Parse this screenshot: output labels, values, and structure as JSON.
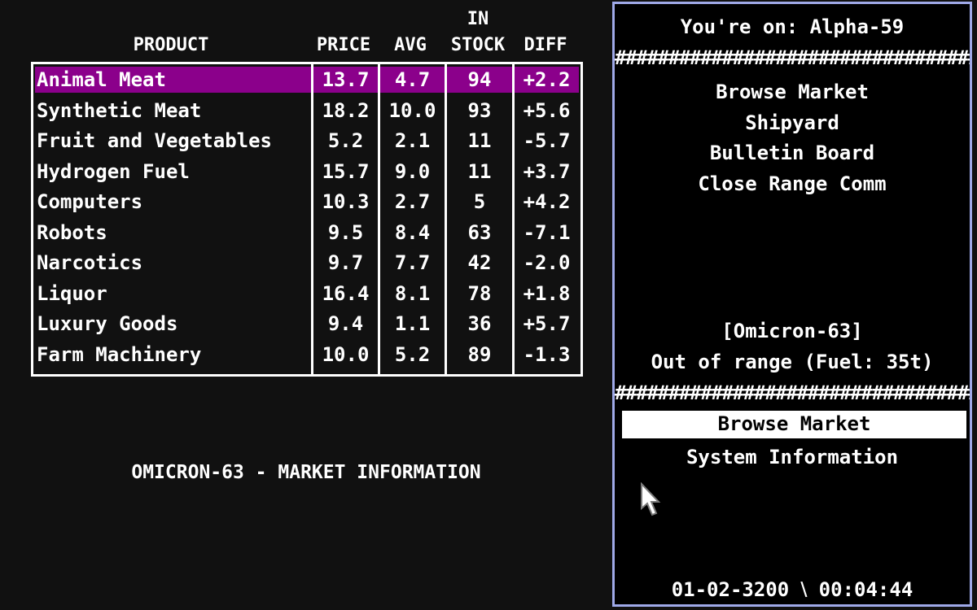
{
  "market": {
    "headers": {
      "product": "PRODUCT",
      "price": "PRICE",
      "avg": "AVG",
      "stock": "IN\nSTOCK",
      "diff": "DIFF"
    },
    "selected_index": 0,
    "rows": [
      {
        "name": "Animal Meat",
        "price": "13.7",
        "avg": "4.7",
        "stock": "94",
        "diff": "+2.2"
      },
      {
        "name": "Synthetic Meat",
        "price": "18.2",
        "avg": "10.0",
        "stock": "93",
        "diff": "+5.6"
      },
      {
        "name": "Fruit and Vegetables",
        "price": "5.2",
        "avg": "2.1",
        "stock": "11",
        "diff": "-5.7"
      },
      {
        "name": "Hydrogen Fuel",
        "price": "15.7",
        "avg": "9.0",
        "stock": "11",
        "diff": "+3.7"
      },
      {
        "name": "Computers",
        "price": "10.3",
        "avg": "2.7",
        "stock": "5",
        "diff": "+4.2"
      },
      {
        "name": "Robots",
        "price": "9.5",
        "avg": "8.4",
        "stock": "63",
        "diff": "-7.1"
      },
      {
        "name": "Narcotics",
        "price": "9.7",
        "avg": "7.7",
        "stock": "42",
        "diff": "-2.0"
      },
      {
        "name": "Liquor",
        "price": "16.4",
        "avg": "8.1",
        "stock": "78",
        "diff": "+1.8"
      },
      {
        "name": "Luxury Goods",
        "price": "9.4",
        "avg": "1.1",
        "stock": "36",
        "diff": "+5.7"
      },
      {
        "name": "Farm Machinery",
        "price": "10.0",
        "avg": "5.2",
        "stock": "89",
        "diff": "-1.3"
      }
    ],
    "title": "OMICRON-63 - MARKET INFORMATION"
  },
  "panel": {
    "location": "You're on: Alpha-59",
    "divider": "########################################",
    "local_menu": [
      "Browse Market",
      "Shipyard",
      "Bulletin Board",
      "Close Range Comm"
    ],
    "target_system": "[Omicron-63]",
    "range_status": "Out of range (Fuel: 35t)",
    "remote_menu": [
      "Browse Market",
      "System Information"
    ],
    "remote_active_index": 0,
    "datetime": "01-02-3200 ⧵ 00:04:44"
  },
  "colors": {
    "highlight": "#8b008b",
    "panel_border": "#9fa9e8",
    "background": "#111111"
  }
}
